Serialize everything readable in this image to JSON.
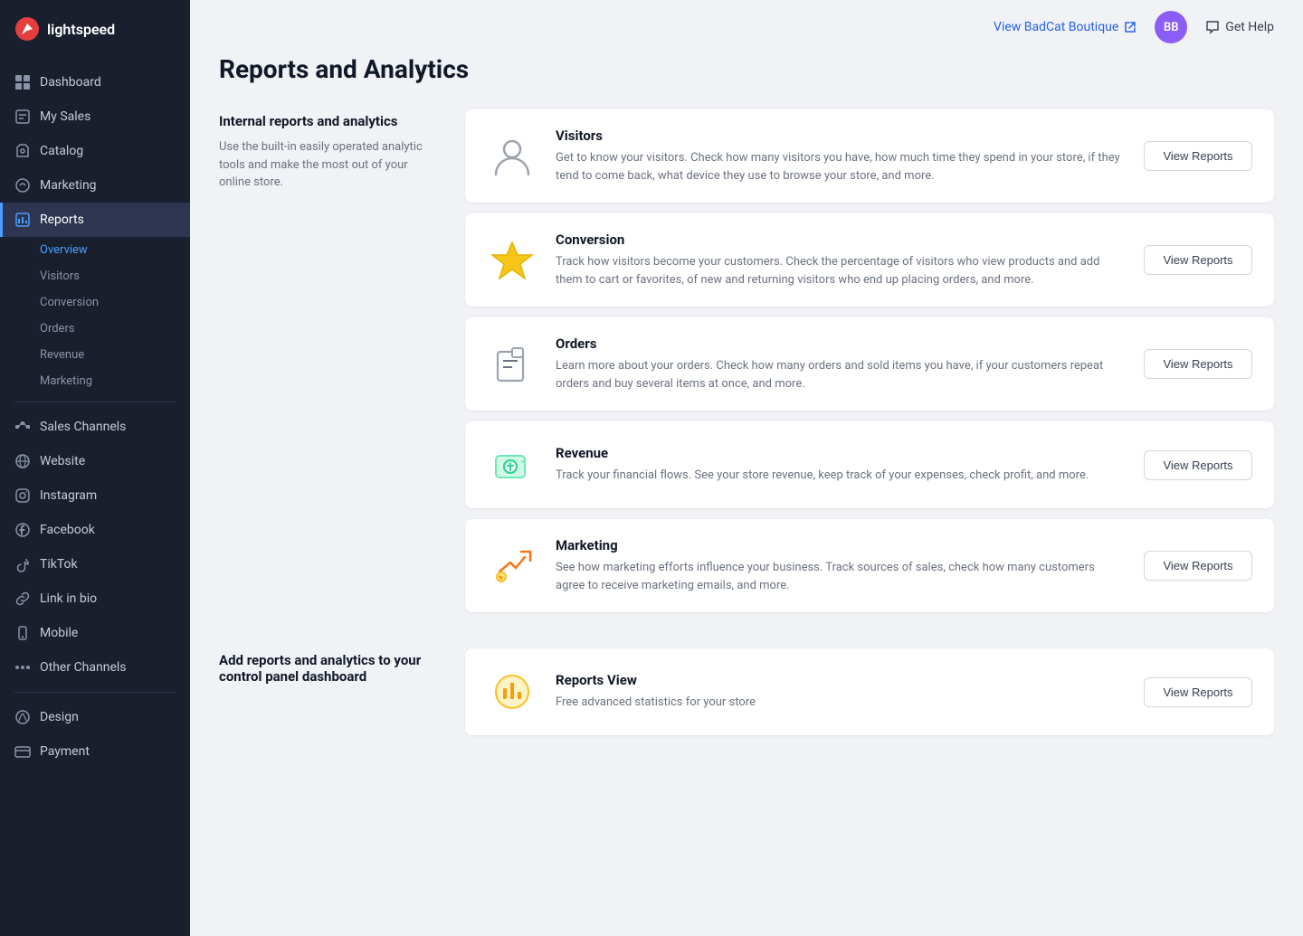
{
  "sidebar": {
    "logo_text": "lightspeed",
    "nav_items": [
      {
        "id": "dashboard",
        "label": "Dashboard",
        "icon": "dashboard"
      },
      {
        "id": "my-sales",
        "label": "My Sales",
        "icon": "sales"
      },
      {
        "id": "catalog",
        "label": "Catalog",
        "icon": "catalog"
      },
      {
        "id": "marketing",
        "label": "Marketing",
        "icon": "marketing"
      },
      {
        "id": "reports",
        "label": "Reports",
        "icon": "reports",
        "active": true
      }
    ],
    "reports_sub": [
      {
        "id": "overview",
        "label": "Overview",
        "active": true
      },
      {
        "id": "visitors",
        "label": "Visitors"
      },
      {
        "id": "conversion",
        "label": "Conversion"
      },
      {
        "id": "orders",
        "label": "Orders"
      },
      {
        "id": "revenue",
        "label": "Revenue"
      },
      {
        "id": "marketing",
        "label": "Marketing"
      }
    ],
    "sales_channels_items": [
      {
        "id": "sales-channels",
        "label": "Sales Channels",
        "icon": "channels"
      },
      {
        "id": "website",
        "label": "Website",
        "icon": "website"
      },
      {
        "id": "instagram",
        "label": "Instagram",
        "icon": "instagram"
      },
      {
        "id": "facebook",
        "label": "Facebook",
        "icon": "facebook"
      },
      {
        "id": "tiktok",
        "label": "TikTok",
        "icon": "tiktok"
      },
      {
        "id": "link-in-bio",
        "label": "Link in bio",
        "icon": "link"
      },
      {
        "id": "mobile",
        "label": "Mobile",
        "icon": "mobile"
      },
      {
        "id": "other-channels",
        "label": "Other Channels",
        "icon": "other"
      }
    ],
    "bottom_items": [
      {
        "id": "design",
        "label": "Design",
        "icon": "design"
      },
      {
        "id": "payment",
        "label": "Payment",
        "icon": "payment"
      }
    ]
  },
  "topbar": {
    "store_link": "View BadCat Boutique",
    "avatar_initials": "BB",
    "help_label": "Get Help"
  },
  "page": {
    "title": "Reports and Analytics",
    "internal_section": {
      "heading": "Internal reports and analytics",
      "description": "Use the built-in easily operated analytic tools and make the most out of your online store."
    },
    "reports": [
      {
        "id": "visitors",
        "title": "Visitors",
        "description": "Get to know your visitors. Check how many visitors you have, how much time they spend in your store, if they tend to come back, what device they use to browse your store, and more.",
        "button_label": "View Reports",
        "icon": "visitors"
      },
      {
        "id": "conversion",
        "title": "Conversion",
        "description": "Track how visitors become your customers. Check the percentage of visitors who view products and add them to cart or favorites, of new and returning visitors who end up placing orders, and more.",
        "button_label": "View Reports",
        "icon": "conversion"
      },
      {
        "id": "orders",
        "title": "Orders",
        "description": "Learn more about your orders. Check how many orders and sold items you have, if your customers repeat orders and buy several items at once, and more.",
        "button_label": "View Reports",
        "icon": "orders"
      },
      {
        "id": "revenue",
        "title": "Revenue",
        "description": "Track your financial flows. See your store revenue, keep track of your expenses, check profit, and more.",
        "button_label": "View Reports",
        "icon": "revenue"
      },
      {
        "id": "marketing",
        "title": "Marketing",
        "description": "See how marketing efforts influence your business. Track sources of sales, check how many customers agree to receive marketing emails, and more.",
        "button_label": "View Reports",
        "icon": "marketing"
      }
    ],
    "bottom_section": {
      "heading": "Add reports and analytics to your control panel dashboard",
      "card_title": "Free advanced statistics for your store"
    },
    "reports_view_card": {
      "title": "Reports View",
      "button_label": "View Reports"
    }
  }
}
